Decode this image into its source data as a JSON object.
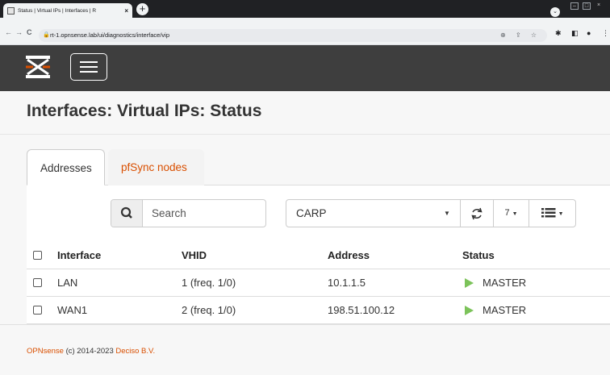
{
  "browser": {
    "tab_title": "Status | Virtual IPs | Interfaces | R",
    "tab_close": "×",
    "new_tab": "+",
    "url": "rt-1.opnsense.lab/ui/diagnostics/interface/vip",
    "nav_back": "←",
    "nav_forward": "→",
    "nav_reload": "C"
  },
  "page": {
    "title": "Interfaces: Virtual IPs: Status"
  },
  "tabs": [
    {
      "label": "Addresses",
      "active": true
    },
    {
      "label": "pfSync nodes",
      "active": false
    }
  ],
  "toolbar": {
    "search_placeholder": "Search",
    "filter_value": "CARP",
    "page_size": "7"
  },
  "table": {
    "columns": [
      "Interface",
      "VHID",
      "Address",
      "Status"
    ],
    "rows": [
      {
        "interface": "LAN",
        "vhid": "1 (freq. 1/0)",
        "address": "10.1.1.5",
        "status": "MASTER"
      },
      {
        "interface": "WAN1",
        "vhid": "2 (freq. 1/0)",
        "address": "198.51.100.12",
        "status": "MASTER"
      }
    ]
  },
  "footer": {
    "brand": "OPNsense",
    "copyright": "(c) 2014-2023",
    "company": "Deciso B.V."
  },
  "colors": {
    "accent": "#d94f00",
    "header_bg": "#3e3e3e",
    "status_green": "#7cc35a"
  },
  "icons": [
    "search-icon",
    "refresh-icon",
    "columns-icon",
    "play-icon",
    "lock-icon",
    "opnsense-logo"
  ]
}
